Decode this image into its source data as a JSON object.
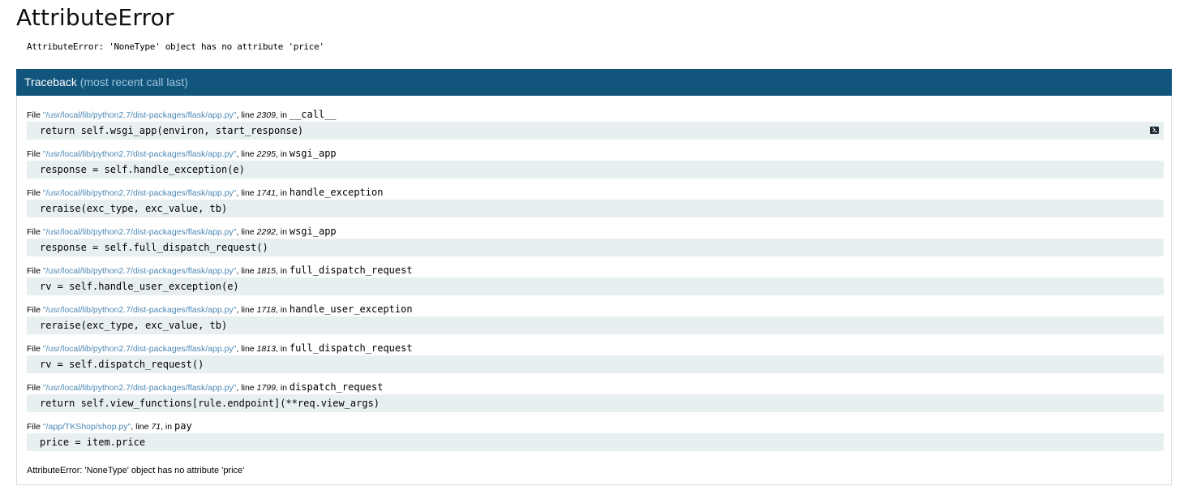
{
  "error": {
    "title": "AttributeError",
    "message": "AttributeError: 'NoneType' object has no attribute 'price'"
  },
  "traceback": {
    "header_label": "Traceback",
    "header_note": "(most recent call last)",
    "file_prefix": "File ",
    "line_prefix": ", line ",
    "in_prefix": ", in ",
    "frames": [
      {
        "file": "\"/usr/local/lib/python2.7/dist-packages/flask/app.py\"",
        "line": "2309",
        "func": "__call__",
        "code": "return self.wsgi_app(environ, start_response)"
      },
      {
        "file": "\"/usr/local/lib/python2.7/dist-packages/flask/app.py\"",
        "line": "2295",
        "func": "wsgi_app",
        "code": "response = self.handle_exception(e)"
      },
      {
        "file": "\"/usr/local/lib/python2.7/dist-packages/flask/app.py\"",
        "line": "1741",
        "func": "handle_exception",
        "code": "reraise(exc_type, exc_value, tb)"
      },
      {
        "file": "\"/usr/local/lib/python2.7/dist-packages/flask/app.py\"",
        "line": "2292",
        "func": "wsgi_app",
        "code": "response = self.full_dispatch_request()"
      },
      {
        "file": "\"/usr/local/lib/python2.7/dist-packages/flask/app.py\"",
        "line": "1815",
        "func": "full_dispatch_request",
        "code": "rv = self.handle_user_exception(e)"
      },
      {
        "file": "\"/usr/local/lib/python2.7/dist-packages/flask/app.py\"",
        "line": "1718",
        "func": "handle_user_exception",
        "code": "reraise(exc_type, exc_value, tb)"
      },
      {
        "file": "\"/usr/local/lib/python2.7/dist-packages/flask/app.py\"",
        "line": "1813",
        "func": "full_dispatch_request",
        "code": "rv = self.dispatch_request()"
      },
      {
        "file": "\"/usr/local/lib/python2.7/dist-packages/flask/app.py\"",
        "line": "1799",
        "func": "dispatch_request",
        "code": "return self.view_functions[rule.endpoint](**req.view_args)"
      },
      {
        "file": "\"/app/TKShop/shop.py\"",
        "line": "71",
        "func": "pay",
        "code": "price = item.price"
      }
    ],
    "footer_message": "AttributeError: 'NoneType' object has no attribute 'price'"
  },
  "icons": {
    "console": "console-icon"
  },
  "colors": {
    "header_bg": "#11557c",
    "header_muted": "#9cc3db",
    "file_link": "#4b87b4",
    "code_bg": "#e8eff0"
  }
}
